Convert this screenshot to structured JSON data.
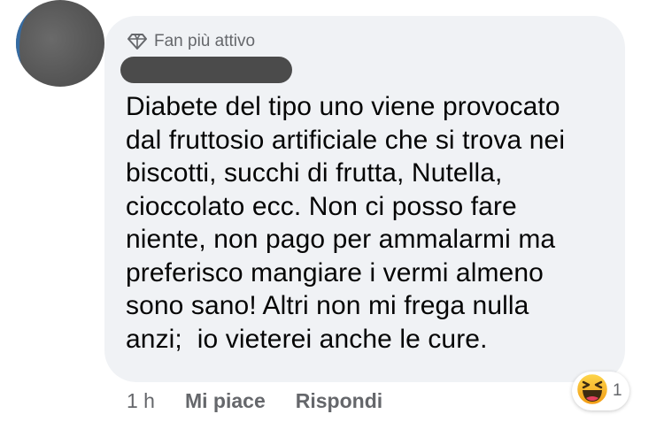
{
  "badge": {
    "label": "Fan più attivo",
    "icon": "diamond-icon"
  },
  "comment": {
    "lines": [
      "Diabete del tipo uno viene provocato",
      "dal fruttosio artificiale che si trova nei",
      "biscotti, succhi di frutta, Nutella,",
      "cioccolato ecc. Non ci posso fare",
      "niente, non pago per ammalarmi ma",
      "preferisco mangiare i vermi almeno",
      "sono sano! Altri non mi frega nulla",
      "anzi;  io vieterei anche le cure."
    ]
  },
  "actions": {
    "time": "1 h",
    "like": "Mi piace",
    "reply": "Rispondi"
  },
  "reactions": {
    "icon": "haha-emoji-icon",
    "count": "1"
  },
  "colors": {
    "bubble": "#f0f2f5",
    "muted_text": "#65676b",
    "text": "#050505",
    "emoji": "#f7b125"
  }
}
